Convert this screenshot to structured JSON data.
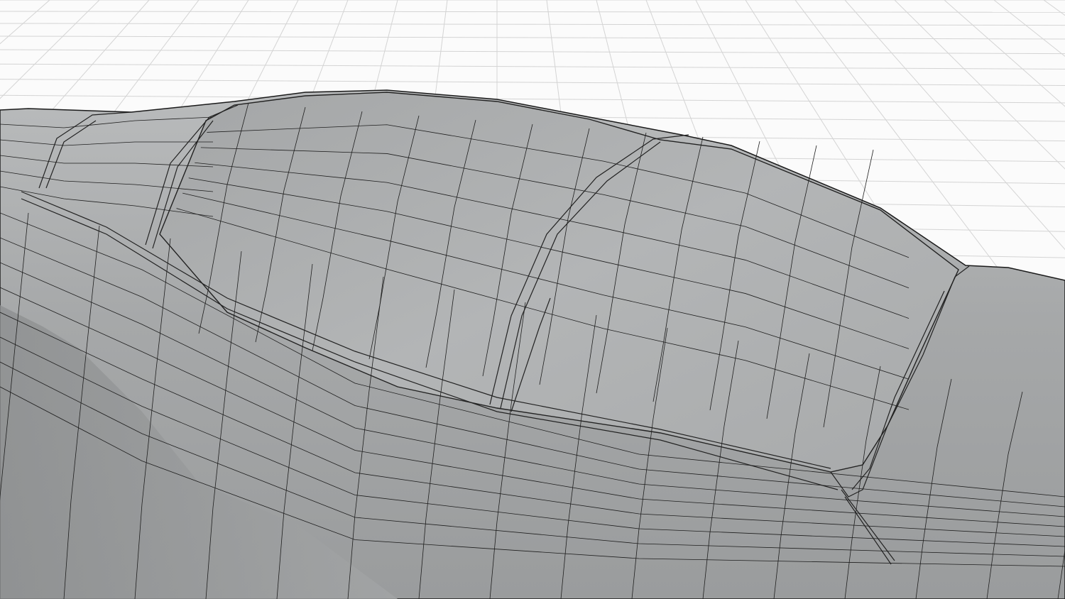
{
  "viewport": {
    "background_color": "#fbfbfb",
    "grid_color": "#d4d4d4",
    "mesh_color": "#a7a9aa",
    "wire_color": "#1e1e1e"
  }
}
